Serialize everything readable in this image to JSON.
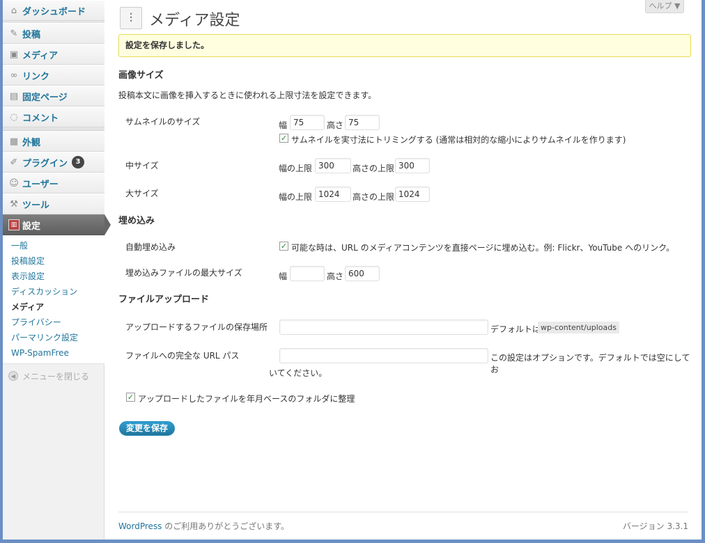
{
  "sidebar": {
    "dashboard": "ダッシュボード",
    "posts": "投稿",
    "media": "メディア",
    "links": "リンク",
    "pages": "固定ページ",
    "comments": "コメント",
    "appearance": "外観",
    "plugins": "プラグイン",
    "plugins_badge": "3",
    "users": "ユーザー",
    "tools": "ツール",
    "settings": "設定",
    "submenu": [
      "一般",
      "投稿設定",
      "表示設定",
      "ディスカッション",
      "メディア",
      "プライバシー",
      "パーマリンク設定",
      "WP-SpamFree"
    ],
    "collapse": "メニューを閉じる"
  },
  "header": {
    "title": "メディア設定",
    "help": "ヘルプ ▼"
  },
  "notice": "設定を保存しました。",
  "image_sizes": {
    "heading": "画像サイズ",
    "description": "投稿本文に画像を挿入するときに使われる上限寸法を設定できます。",
    "thumbnail": {
      "label": "サムネイルのサイズ",
      "width_label": "幅",
      "width": "75",
      "height_label": "高さ",
      "height": "75",
      "crop_label": "サムネイルを実寸法にトリミングする (通常は相対的な縮小によりサムネイルを作ります)",
      "crop_checked": true
    },
    "medium": {
      "label": "中サイズ",
      "width_label": "幅の上限",
      "width": "300",
      "height_label": "高さの上限",
      "height": "300"
    },
    "large": {
      "label": "大サイズ",
      "width_label": "幅の上限",
      "width": "1024",
      "height_label": "高さの上限",
      "height": "1024"
    }
  },
  "embeds": {
    "heading": "埋め込み",
    "auto": {
      "label": "自動埋め込み",
      "check_label": "可能な時は、URL のメディアコンテンツを直接ページに埋め込む。例: Flickr、YouTube へのリンク。",
      "checked": true
    },
    "max_size": {
      "label": "埋め込みファイルの最大サイズ",
      "width_label": "幅",
      "width": "",
      "height_label": "高さ",
      "height": "600"
    }
  },
  "uploading": {
    "heading": "ファイルアップロード",
    "path": {
      "label": "アップロードするファイルの保存場所",
      "value": "",
      "default_text": "デフォルトは",
      "default_code": "wp-content/uploads"
    },
    "url": {
      "label": "ファイルへの完全な URL パス",
      "value": "",
      "help_line1": "この設定はオプションです。デフォルトでは空にしてお",
      "help_line2": "いてください。"
    },
    "organize": {
      "label": "アップロードしたファイルを年月ベースのフォルダに整理",
      "checked": true
    }
  },
  "save_button": "変更を保存",
  "footer": {
    "link": "WordPress",
    "thanks": " のご利用ありがとうございます。",
    "version": "バージョン 3.3.1"
  }
}
